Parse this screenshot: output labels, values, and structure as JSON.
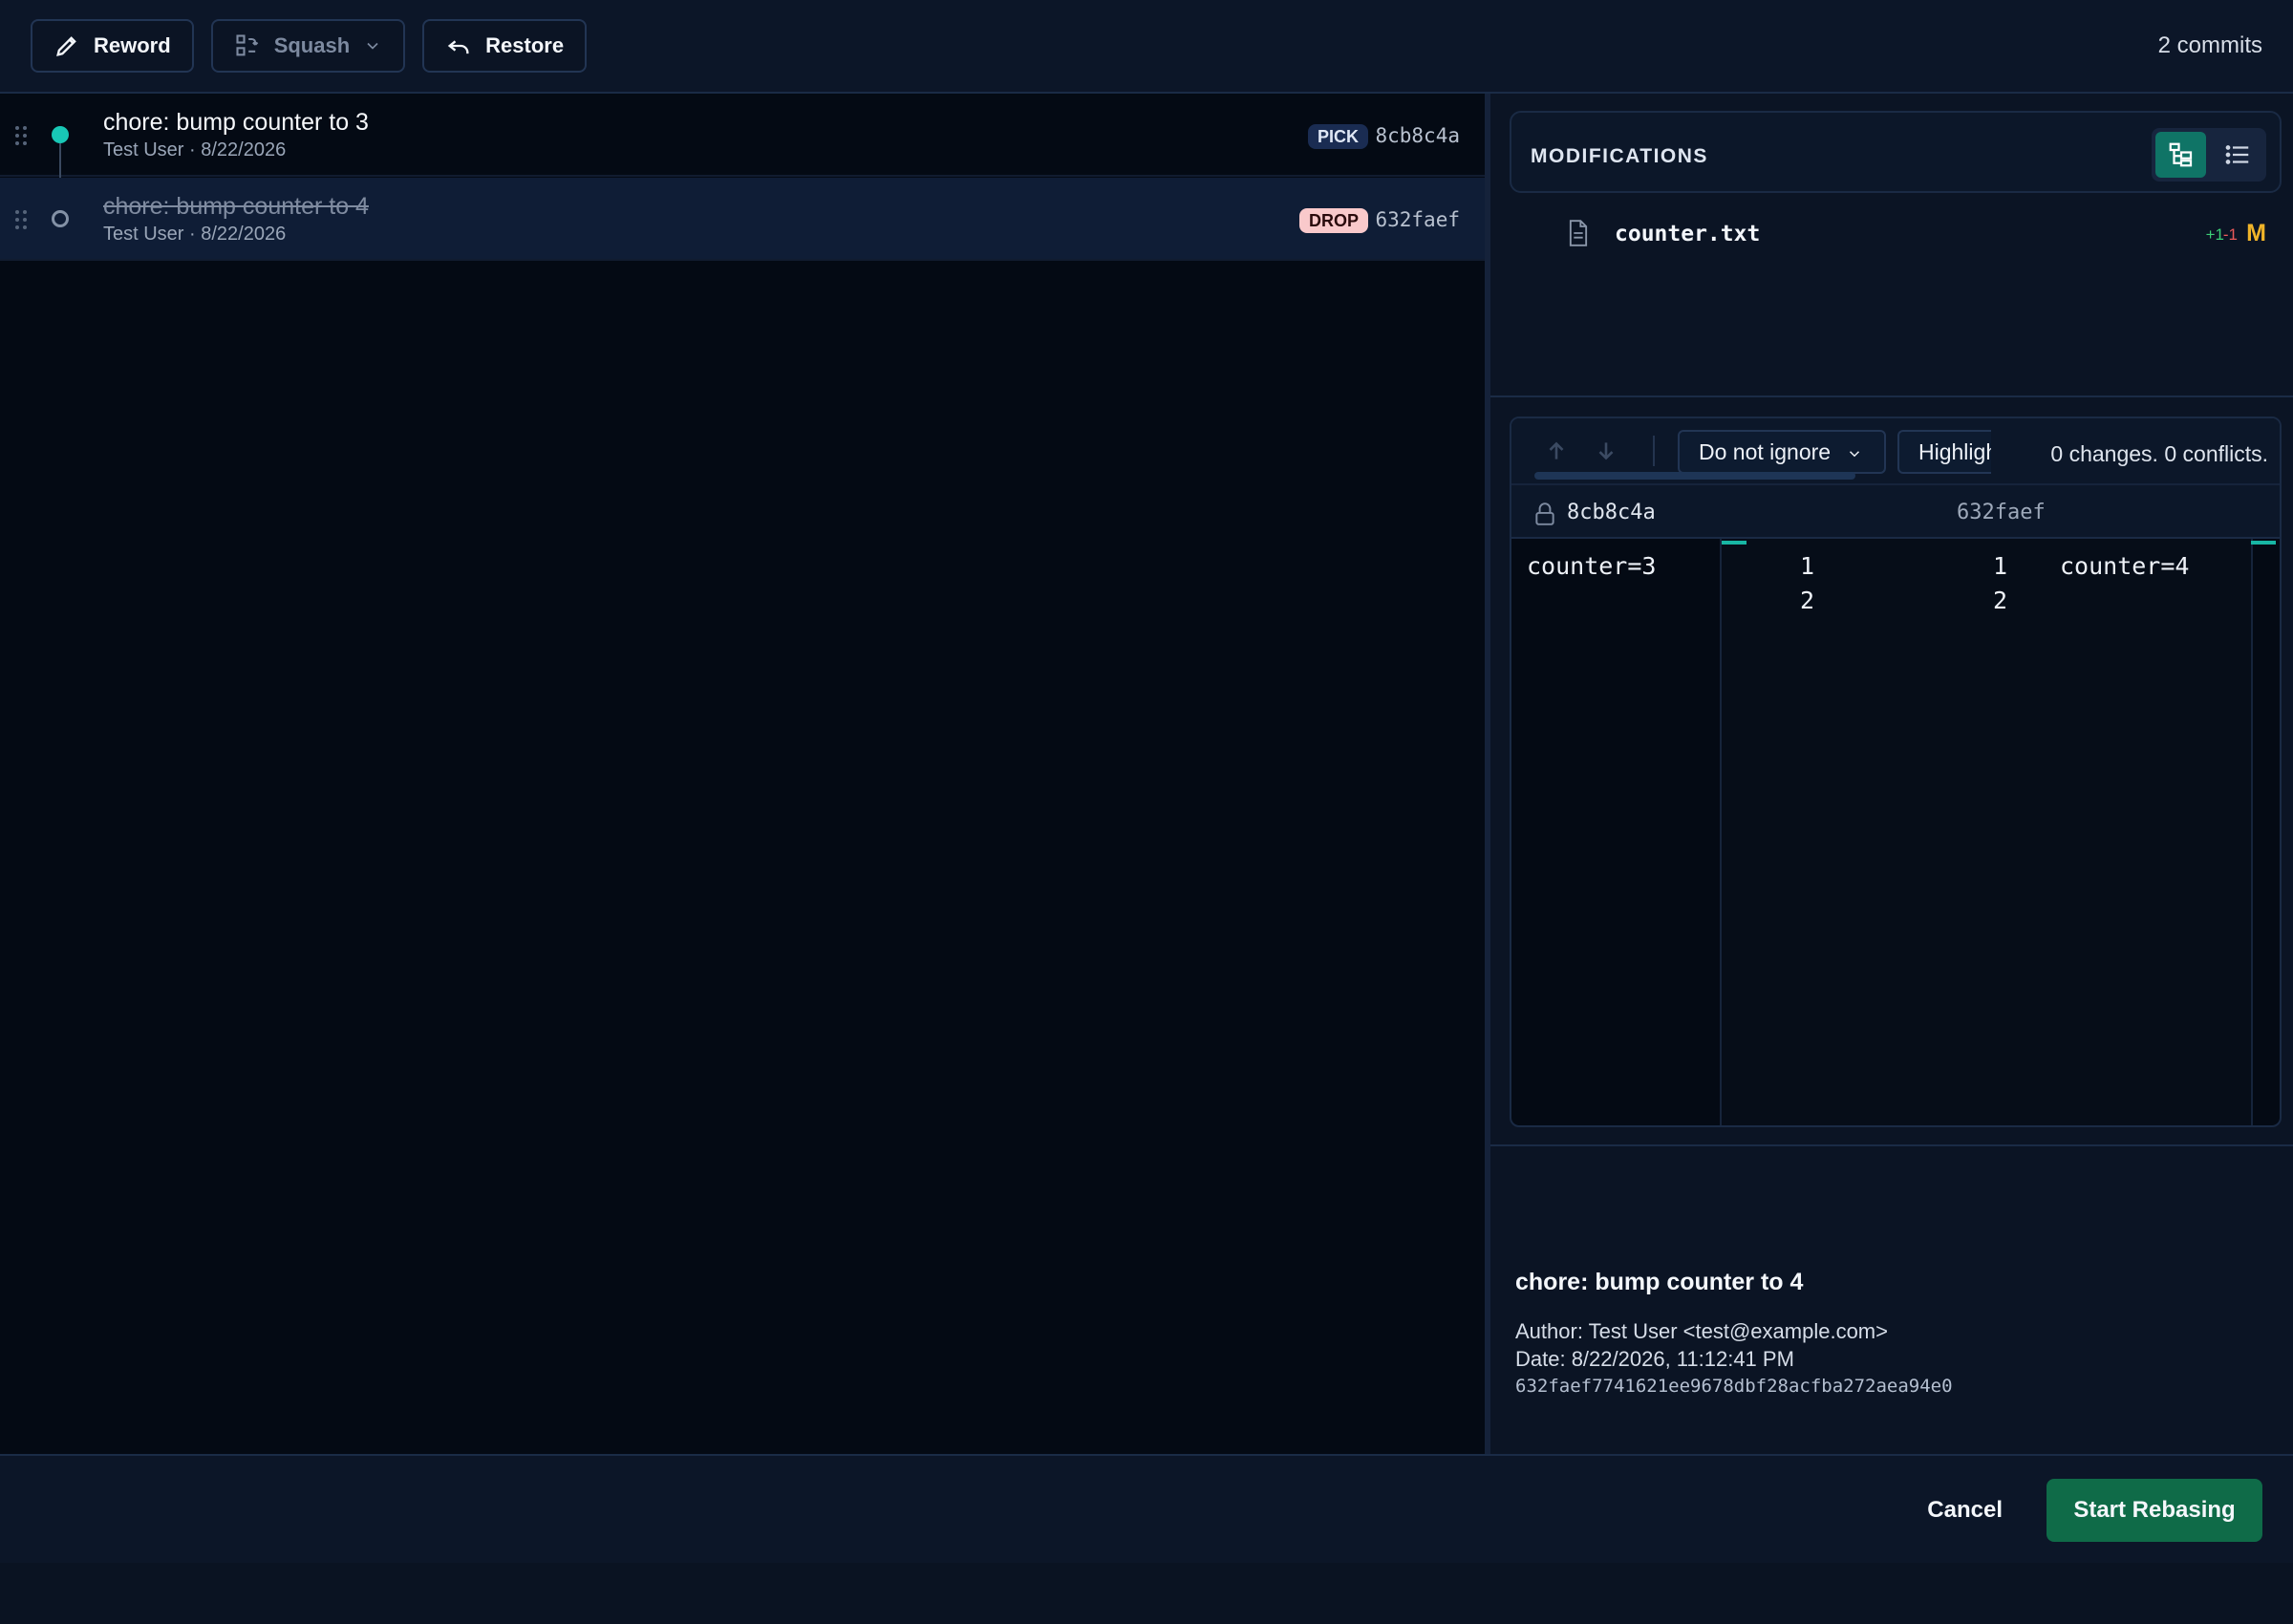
{
  "toolbar": {
    "reword_label": "Reword",
    "squash_label": "Squash",
    "restore_label": "Restore",
    "commit_count": "2 commits"
  },
  "commits": [
    {
      "title": "chore: bump counter to 3",
      "meta": "Test User · 8/22/2026",
      "action": "PICK",
      "hash": "8cb8c4a"
    },
    {
      "title": "chore: bump counter to 4",
      "meta": "Test User · 8/22/2026",
      "action": "DROP",
      "hash": "632faef"
    }
  ],
  "modifications": {
    "title": "MODIFICATIONS",
    "files": [
      {
        "name": "counter.txt",
        "additions": "+1",
        "deletions": "-1",
        "status": "M"
      }
    ]
  },
  "diff": {
    "whitespace_option": "Do not ignore",
    "highlight_option": "Highlight",
    "summary": "0 changes. 0 conflicts.",
    "left_ref": "8cb8c4a",
    "right_ref": "632faef",
    "left_lines": [
      "counter=3",
      ""
    ],
    "right_lines": [
      "counter=4",
      ""
    ],
    "left_numbers": [
      "1",
      "2"
    ],
    "right_numbers": [
      "1",
      "2"
    ]
  },
  "details": {
    "title": "chore: bump counter to 4",
    "author": "Author: Test User <test@example.com>",
    "date": "Date: 8/22/2026, 11:12:41 PM",
    "full_hash": "632faef7741621ee9678dbf28acfba272aea94e0"
  },
  "footer": {
    "cancel_label": "Cancel",
    "start_label": "Start Rebasing"
  },
  "colors": {
    "accent": "#18c8b6",
    "primary_button": "#0f6b48",
    "drop_badge": "#f9c9cb",
    "modified_status": "#f0b429"
  }
}
